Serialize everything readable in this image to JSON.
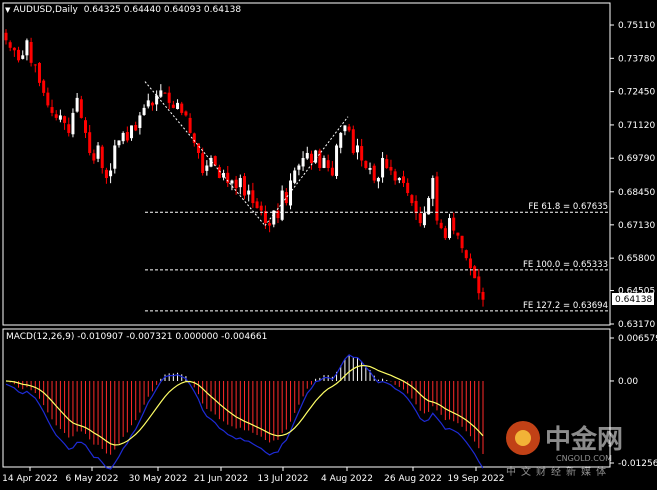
{
  "header": {
    "arrow": "▼",
    "symbol": "AUDUSD,Daily",
    "ohlc": "0.64325 0.64440 0.64093 0.64138"
  },
  "macd": {
    "label": "MACD(12,26,9) -0.010907 -0.007321 0.000000 -0.004661"
  },
  "price_axis": {
    "ticks": [
      "0.75110",
      "0.73780",
      "0.72450",
      "0.71120",
      "0.69790",
      "0.68450",
      "0.67130",
      "0.65800",
      "0.64505",
      "0.63170"
    ],
    "current_price": "0.64138"
  },
  "macd_axis": {
    "ticks": [
      "0.006579",
      "0.00",
      "-0.01256"
    ]
  },
  "time_axis": {
    "ticks": [
      "14 Apr 2022",
      "6 May 2022",
      "30 May 2022",
      "21 Jun 2022",
      "13 Jul 2022",
      "4 Aug 2022",
      "26 Aug 2022",
      "19 Sep 2022"
    ]
  },
  "fib_levels": [
    {
      "label": "FE 61.8 = 0.67635",
      "price": 0.67635
    },
    {
      "label": "FE 100.0 = 0.65333",
      "price": 0.65333
    },
    {
      "label": "FE 127.2 = 0.63694",
      "price": 0.63694
    }
  ],
  "watermark": {
    "brand": "中金网",
    "site": "CNGOLD.COM",
    "sub": "中文财经新媒体"
  },
  "colors": {
    "background": "#000000",
    "bull_candle": "#ffffff",
    "bear_candle": "#ff0000",
    "macd_main": "#1e2bd6",
    "macd_signal": "#ffff66",
    "hist_pos": "#ffffff",
    "hist_neg": "#ff2a2a",
    "grid": "#ffffff"
  },
  "chart_data": {
    "type": "candlestick",
    "symbol": "AUDUSD",
    "timeframe": "Daily",
    "ylim": [
      0.6317,
      0.7555
    ],
    "close_path": [
      0.745,
      0.742,
      0.741,
      0.737,
      0.739,
      0.745,
      0.736,
      0.735,
      0.728,
      0.724,
      0.719,
      0.716,
      0.714,
      0.715,
      0.712,
      0.708,
      0.716,
      0.722,
      0.714,
      0.708,
      0.7,
      0.697,
      0.703,
      0.694,
      0.69,
      0.693,
      0.703,
      0.705,
      0.708,
      0.705,
      0.711,
      0.709,
      0.715,
      0.718,
      0.721,
      0.719,
      0.723,
      0.725,
      0.724,
      0.72,
      0.718,
      0.72,
      0.716,
      0.715,
      0.708,
      0.704,
      0.7,
      0.692,
      0.695,
      0.698,
      0.695,
      0.69,
      0.692,
      0.688,
      0.689,
      0.686,
      0.69,
      0.683,
      0.685,
      0.68,
      0.678,
      0.677,
      0.672,
      0.671,
      0.677,
      0.674,
      0.685,
      0.68,
      0.689,
      0.693,
      0.695,
      0.698,
      0.7,
      0.696,
      0.701,
      0.694,
      0.698,
      0.694,
      0.691,
      0.703,
      0.708,
      0.711,
      0.709,
      0.7,
      0.703,
      0.697,
      0.694,
      0.694,
      0.689,
      0.69,
      0.698,
      0.694,
      0.693,
      0.689,
      0.69,
      0.688,
      0.684,
      0.68,
      0.676,
      0.672,
      0.676,
      0.682,
      0.69,
      0.673,
      0.67,
      0.666,
      0.674,
      0.669,
      0.667,
      0.662,
      0.658,
      0.654,
      0.65,
      0.644,
      0.6414
    ]
  }
}
